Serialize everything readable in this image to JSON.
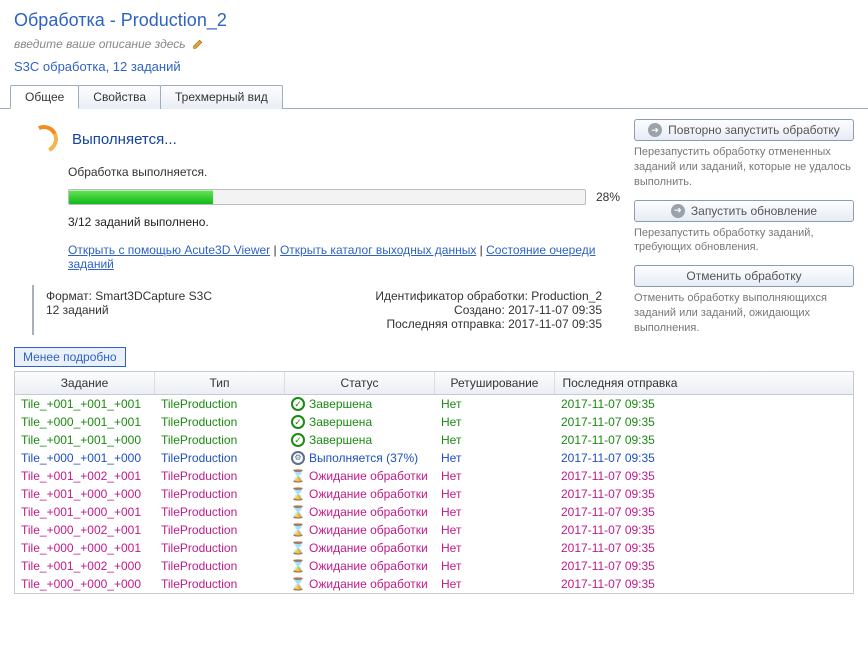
{
  "header": {
    "title": "Обработка - Production_2",
    "desc_placeholder": "введите ваше описание здесь",
    "summary": "S3C обработка, 12 заданий"
  },
  "tabs": {
    "general": "Общее",
    "props": "Свойства",
    "view3d": "Трехмерный вид"
  },
  "progress": {
    "title": "Выполняется...",
    "subtitle": "Обработка выполняется.",
    "pct_label": "28%",
    "tasks_done": "3/12 заданий выполнено."
  },
  "links": {
    "viewer": "Открыть с помощью Acute3D Viewer",
    "output_dir": "Открыть каталог выходных данных",
    "queue": "Состояние очереди заданий"
  },
  "meta": {
    "format_label": "Формат: Smart3DCapture S3C",
    "tasks_count": "12 заданий",
    "id_label": "Идентификатор обработки: Production_2",
    "created_label": "Создано: 2017-11-07 09:35",
    "last_submit_label": "Последняя отправка: 2017-11-07 09:35"
  },
  "side": {
    "resubmit_btn": "Повторно запустить обработку",
    "resubmit_desc": "Перезапустить обработку отмененных заданий или заданий, которые не удалось выполнить.",
    "update_btn": "Запустить обновление",
    "update_desc": "Перезапустить обработку заданий, требующих обновления.",
    "cancel_btn": "Отменить обработку",
    "cancel_desc": "Отменить обработку выполняющихся заданий или заданий, ожидающих выполнения."
  },
  "less_btn": "Менее подробно",
  "grid": {
    "headers": {
      "task": "Задание",
      "type": "Тип",
      "status": "Статус",
      "retouch": "Ретуширование",
      "last": "Последняя отправка"
    },
    "rows": [
      {
        "task": "Tile_+001_+001_+001",
        "type": "TileProduction",
        "status_code": "done",
        "status": "Завершена",
        "retouch": "Нет",
        "last": "2017-11-07 09:35"
      },
      {
        "task": "Tile_+000_+001_+001",
        "type": "TileProduction",
        "status_code": "done",
        "status": "Завершена",
        "retouch": "Нет",
        "last": "2017-11-07 09:35"
      },
      {
        "task": "Tile_+001_+001_+000",
        "type": "TileProduction",
        "status_code": "done",
        "status": "Завершена",
        "retouch": "Нет",
        "last": "2017-11-07 09:35"
      },
      {
        "task": "Tile_+000_+001_+000",
        "type": "TileProduction",
        "status_code": "run",
        "status": "Выполняется (37%)",
        "retouch": "Нет",
        "last": "2017-11-07 09:35"
      },
      {
        "task": "Tile_+001_+002_+001",
        "type": "TileProduction",
        "status_code": "wait",
        "status": "Ожидание обработки",
        "retouch": "Нет",
        "last": "2017-11-07 09:35"
      },
      {
        "task": "Tile_+001_+000_+000",
        "type": "TileProduction",
        "status_code": "wait",
        "status": "Ожидание обработки",
        "retouch": "Нет",
        "last": "2017-11-07 09:35"
      },
      {
        "task": "Tile_+001_+000_+001",
        "type": "TileProduction",
        "status_code": "wait",
        "status": "Ожидание обработки",
        "retouch": "Нет",
        "last": "2017-11-07 09:35"
      },
      {
        "task": "Tile_+000_+002_+001",
        "type": "TileProduction",
        "status_code": "wait",
        "status": "Ожидание обработки",
        "retouch": "Нет",
        "last": "2017-11-07 09:35"
      },
      {
        "task": "Tile_+000_+000_+001",
        "type": "TileProduction",
        "status_code": "wait",
        "status": "Ожидание обработки",
        "retouch": "Нет",
        "last": "2017-11-07 09:35"
      },
      {
        "task": "Tile_+001_+002_+000",
        "type": "TileProduction",
        "status_code": "wait",
        "status": "Ожидание обработки",
        "retouch": "Нет",
        "last": "2017-11-07 09:35"
      },
      {
        "task": "Tile_+000_+000_+000",
        "type": "TileProduction",
        "status_code": "wait",
        "status": "Ожидание обработки",
        "retouch": "Нет",
        "last": "2017-11-07 09:35"
      }
    ]
  }
}
